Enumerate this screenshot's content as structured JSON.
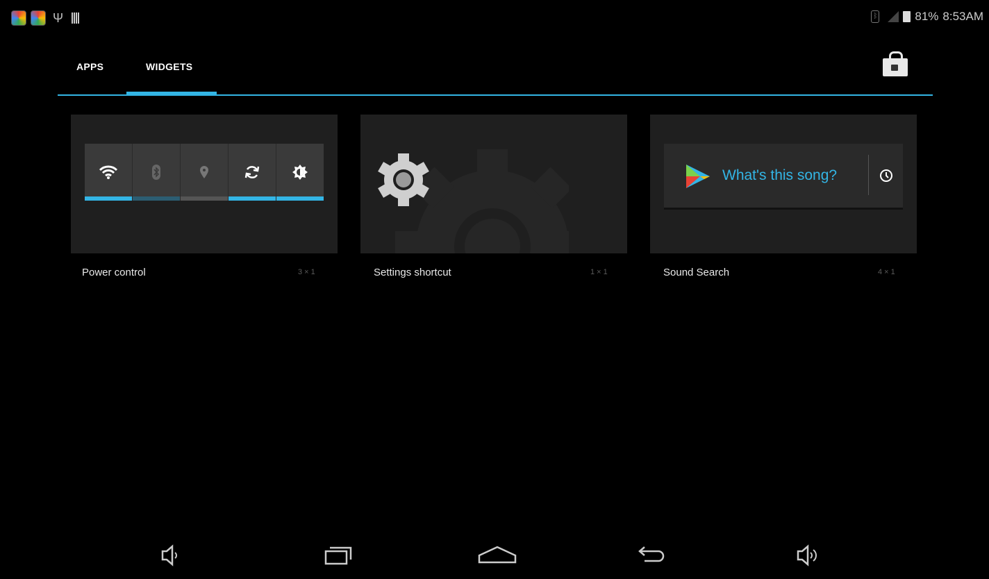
{
  "status_bar": {
    "battery": "81%",
    "time": "8:53AM"
  },
  "tabs": [
    {
      "label": "APPS",
      "selected": false
    },
    {
      "label": "WIDGETS",
      "selected": true
    }
  ],
  "accent_color": "#33b5e5",
  "widgets": [
    {
      "label": "Power control",
      "size": "3 × 1"
    },
    {
      "label": "Settings shortcut",
      "size": "1 × 1"
    },
    {
      "label": "Sound Search",
      "size": "4 × 1",
      "preview_text": "What's this song?"
    }
  ],
  "icons": {
    "status_left": [
      "app-notification-icon",
      "app-notification-icon",
      "usb-icon",
      "barcode-icon"
    ],
    "status_right": [
      "bluetooth-icon",
      "signal-icon",
      "battery-icon"
    ],
    "store": "play-store-icon",
    "power_control": [
      "wifi-icon",
      "bluetooth-icon",
      "location-icon",
      "sync-icon",
      "brightness-icon"
    ],
    "nav": [
      "volume-down-icon",
      "recent-apps-icon",
      "home-icon",
      "back-icon",
      "volume-up-icon"
    ]
  }
}
